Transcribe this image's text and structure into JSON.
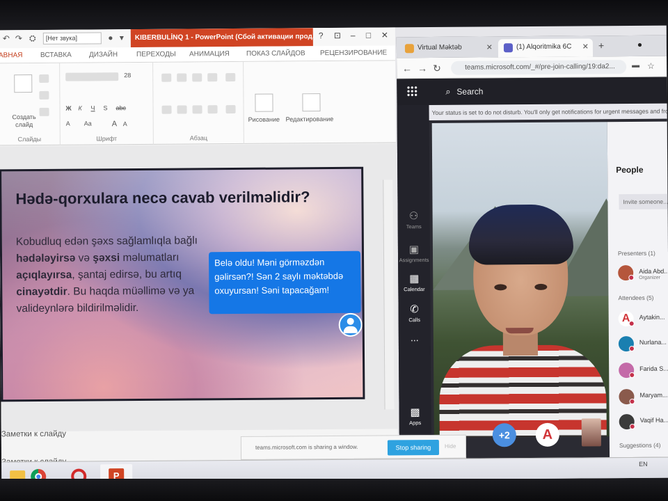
{
  "powerpoint": {
    "qat": {
      "audio_dropdown": "[Нет звука]"
    },
    "title": "KIBERBULİNQ 1 - PowerPoint (Сбой активации прод...",
    "window_buttons": [
      "?",
      "⊡",
      "–",
      "□",
      "✕"
    ],
    "tabs": [
      {
        "label": "АВНАЯ",
        "active": true
      },
      {
        "label": "ВСТАВКА",
        "active": false
      },
      {
        "label": "ДИЗАЙН",
        "active": false
      },
      {
        "label": "ПЕРЕХОДЫ",
        "active": false
      },
      {
        "label": "АНИМАЦИЯ",
        "active": false
      },
      {
        "label": "ПОКАЗ СЛАЙДОВ",
        "active": false
      },
      {
        "label": "РЕЦЕНЗИРОВАНИЕ",
        "active": false
      }
    ],
    "ribbon": {
      "new_slide_label": "Создать слайд",
      "groups": [
        "Слайды",
        "Шрифт",
        "Абзац"
      ],
      "font_size": "28",
      "font_buttons": [
        "Ж",
        "К",
        "Ч",
        "S",
        "abc",
        "A",
        "Aa",
        "A",
        "A"
      ],
      "drawing_label": "Рисование",
      "editing_label": "Редактирование"
    },
    "slide": {
      "title": "Hədə-qorxulara necə cavab verilməlidir?",
      "body_parts": [
        {
          "text": "Kobudluq edən şəxs sağlamlıqla bağlı ",
          "bold": false
        },
        {
          "text": "hədələyirsə",
          "bold": true
        },
        {
          "text": " və ",
          "bold": false
        },
        {
          "text": "şəxsi",
          "bold": true
        },
        {
          "text": " məlumatları ",
          "bold": false
        },
        {
          "text": "açıqlayırsa",
          "bold": true
        },
        {
          "text": ", şantaj edirsə, bu artıq ",
          "bold": false
        },
        {
          "text": "cinayətdir",
          "bold": true
        },
        {
          "text": ". Bu haqda müəllimə və ya valideynlərə bildirilməlidir.",
          "bold": false
        }
      ],
      "bubble_text": "Belə oldu! Məni görməzdən gəlirsən?! Sən 2 saylı məktəbdə oxuyursan! Səni tapacağam!"
    },
    "notes_label": "Заметки к слайду"
  },
  "browser": {
    "tabs": [
      {
        "title": "Virtual Məktəb",
        "active": false,
        "color": "#e8a23b"
      },
      {
        "title": "(1) Alqoritmika 6C",
        "active": true,
        "color": "#5b5fc7"
      }
    ],
    "new_tab": "+",
    "url": "teams.microsoft.com/_#/pre-join-calling/19:da2..."
  },
  "teams": {
    "search_label": "Search",
    "dnd_banner": "Your status is set to do not disturb. You'll only get notifications for urgent messages and from...",
    "rail": [
      {
        "label": "Teams",
        "icon": "teams-icon",
        "glyph": "⚇",
        "lit": false
      },
      {
        "label": "Assignments",
        "icon": "assignments-icon",
        "glyph": "▣",
        "lit": false
      },
      {
        "label": "Calendar",
        "icon": "calendar-icon",
        "glyph": "▦",
        "lit": true
      },
      {
        "label": "Calls",
        "icon": "calls-icon",
        "glyph": "✆",
        "lit": true
      },
      {
        "label": "...",
        "icon": "more-icon",
        "glyph": "",
        "lit": true
      },
      {
        "label": "Apps",
        "icon": "apps-icon",
        "glyph": "▩",
        "lit": true
      }
    ],
    "video_tiles": [
      {
        "label": "+2",
        "bg": "#4b8fe0",
        "color": "#ffffff"
      },
      {
        "label": "A",
        "bg": "#ffffff",
        "color": "#d13438"
      }
    ],
    "people_panel": {
      "title": "People",
      "invite_placeholder": "Invite someone...",
      "presenters_header": "Presenters (1)",
      "attendees_header": "Attendees (5)",
      "suggestions_header": "Suggestions (4)",
      "presenters": [
        {
          "name": "Aida Abd...",
          "role": "Organizer",
          "color": "#b5563c"
        }
      ],
      "attendees": [
        {
          "name": "Aytakin...",
          "color": "#ffffff",
          "letter": "A"
        },
        {
          "name": "Nurlana...",
          "color": "#1a7fb0",
          "letter": ""
        },
        {
          "name": "Farida S...",
          "color": "#c46aa8",
          "letter": ""
        },
        {
          "name": "Maryam...",
          "color": "#8a5a4c",
          "letter": ""
        },
        {
          "name": "Vaqif Ha...",
          "color": "#3b3b3b",
          "letter": ""
        }
      ]
    },
    "share_bar": {
      "text": "teams.microsoft.com is sharing a window.",
      "stop_label": "Stop sharing",
      "hide_label": "Hide"
    }
  },
  "taskbar": {
    "apps": [
      {
        "name": "explorer-icon",
        "color": "#f2c044"
      },
      {
        "name": "chrome-icon",
        "color": "#4285f4"
      },
      {
        "name": "opera-icon",
        "color": "#d12a2a"
      },
      {
        "name": "powerpoint-icon",
        "color": "#d04423"
      }
    ],
    "clock": "EN"
  }
}
